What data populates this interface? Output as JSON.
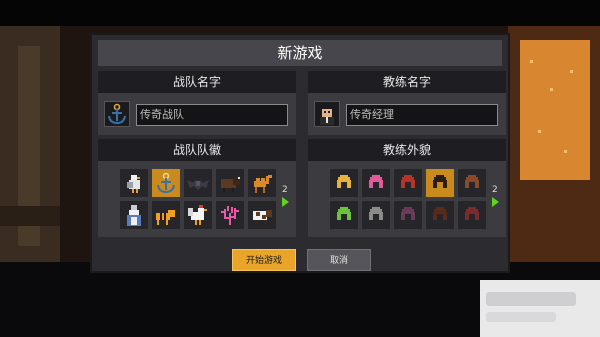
{
  "dialog": {
    "title": "新游戏",
    "team_name": {
      "header": "战队名字",
      "placeholder": "传奇战队",
      "avatar_icon": "anchor-icon"
    },
    "coach_name": {
      "header": "教练名字",
      "placeholder": "传奇经理",
      "avatar_icon": "coach-portrait-icon"
    },
    "team_logo": {
      "header": "战队队徽",
      "page": "2",
      "items": [
        {
          "icon": "seagull-icon",
          "selected": false
        },
        {
          "icon": "anchor-icon",
          "selected": true
        },
        {
          "icon": "bat-icon",
          "selected": false
        },
        {
          "icon": "bison-icon",
          "selected": false
        },
        {
          "icon": "camel-icon",
          "selected": false
        },
        {
          "icon": "wizard-icon",
          "selected": false
        },
        {
          "icon": "tiger-icon",
          "selected": false
        },
        {
          "icon": "rooster-icon",
          "selected": false
        },
        {
          "icon": "coral-icon",
          "selected": false
        },
        {
          "icon": "cow-icon",
          "selected": false
        }
      ]
    },
    "coach_look": {
      "header": "教练外貌",
      "page": "2",
      "items": [
        {
          "icon": "hair-blonde-icon",
          "color": "#e8b23a",
          "selected": false
        },
        {
          "icon": "hair-pink-icon",
          "color": "#e25a9a",
          "selected": false
        },
        {
          "icon": "hair-red-icon",
          "color": "#b8322a",
          "selected": false
        },
        {
          "icon": "hair-black-icon",
          "color": "#2a1d18",
          "selected": true
        },
        {
          "icon": "hair-brown-icon",
          "color": "#8a4a2a",
          "selected": false
        },
        {
          "icon": "hair-green-icon",
          "color": "#6cc238",
          "selected": false
        },
        {
          "icon": "hair-gray-icon",
          "color": "#8a8a8a",
          "selected": false
        },
        {
          "icon": "hair-purple-icon",
          "color": "#6a3a5a",
          "selected": false
        },
        {
          "icon": "hair-dark-brown-icon",
          "color": "#5a2a1a",
          "selected": false
        },
        {
          "icon": "hair-maroon-icon",
          "color": "#7a2a2a",
          "selected": false
        }
      ]
    },
    "buttons": {
      "start": "开始游戏",
      "cancel": "取消"
    },
    "colors": {
      "accent": "#e9a52a",
      "selected_cell": "#c98a1e",
      "next_arrow": "#5fd31f"
    }
  }
}
